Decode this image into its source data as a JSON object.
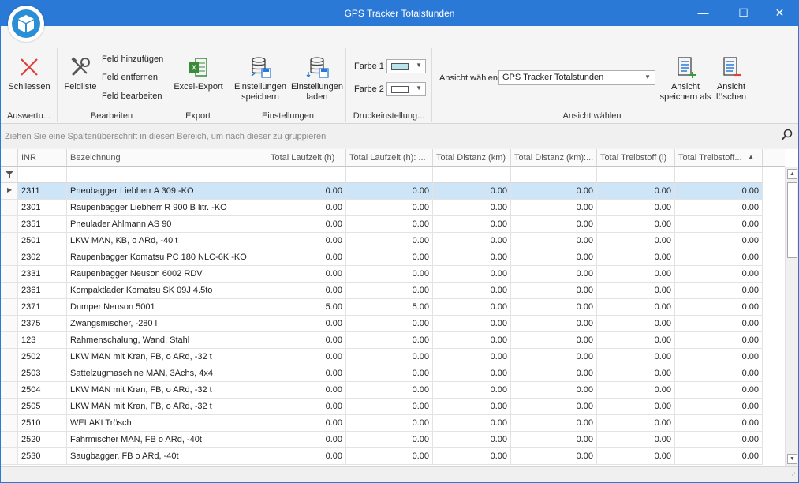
{
  "window": {
    "title": "GPS Tracker Totalstunden",
    "minimize_glyph": "—",
    "maximize_glyph": "☐",
    "close_glyph": "✕"
  },
  "ribbon": {
    "groups": {
      "auswertung": {
        "label": "Auswertu...",
        "close_label": "Schliessen",
        "close_icon": "red-x-icon"
      },
      "bearbeiten": {
        "label": "Bearbeiten",
        "fieldlist_label": "Feldliste",
        "add_field": "Feld hinzufügen",
        "remove_field": "Feld entfernen",
        "edit_field": "Feld bearbeiten"
      },
      "export": {
        "label": "Export",
        "excel_label": "Excel-Export"
      },
      "einstellungen": {
        "label": "Einstellungen",
        "save_line1": "Einstellungen",
        "save_line2": "speichern",
        "load_line1": "Einstellungen",
        "load_line2": "laden"
      },
      "druck": {
        "label": "Druckeinstellung...",
        "color1_label": "Farbe 1",
        "color1_value": "#b7e4ee",
        "color2_label": "Farbe 2",
        "color2_value": "#ffffff"
      },
      "ansicht": {
        "label": "Ansicht wählen",
        "select_label": "Ansicht wählen",
        "selected_view": "GPS Tracker Totalstunden",
        "save_as_line1": "Ansicht",
        "save_as_line2": "speichern als",
        "delete_line1": "Ansicht",
        "delete_line2": "löschen"
      }
    }
  },
  "groupbar": {
    "hint": "Ziehen Sie eine Spaltenüberschrift in diesen Bereich, um nach dieser zu gruppieren"
  },
  "grid": {
    "columns": [
      "INR",
      "Bezeichnung",
      "Total Laufzeit (h)",
      "Total Laufzeit (h): ...",
      "Total Distanz (km)",
      "Total Distanz (km):...",
      "Total Treibstoff (l)",
      "Total Treibstoff..."
    ],
    "sort_glyph": "▲",
    "rows": [
      {
        "inr": "2311",
        "bez": "Pneubagger Liebherr A 309 -KO",
        "lz": "0.00",
        "lz2": "0.00",
        "d": "0.00",
        "d2": "0.00",
        "t": "0.00",
        "t2": "0.00"
      },
      {
        "inr": "2301",
        "bez": "Raupenbagger Liebherr R 900 B litr. -KO",
        "lz": "0.00",
        "lz2": "0.00",
        "d": "0.00",
        "d2": "0.00",
        "t": "0.00",
        "t2": "0.00"
      },
      {
        "inr": "2351",
        "bez": "Pneulader Ahlmann AS 90",
        "lz": "0.00",
        "lz2": "0.00",
        "d": "0.00",
        "d2": "0.00",
        "t": "0.00",
        "t2": "0.00"
      },
      {
        "inr": "2501",
        "bez": "LKW MAN, KB, o ARd, -40 t",
        "lz": "0.00",
        "lz2": "0.00",
        "d": "0.00",
        "d2": "0.00",
        "t": "0.00",
        "t2": "0.00"
      },
      {
        "inr": "2302",
        "bez": "Raupenbagger Komatsu PC 180 NLC-6K -KO",
        "lz": "0.00",
        "lz2": "0.00",
        "d": "0.00",
        "d2": "0.00",
        "t": "0.00",
        "t2": "0.00"
      },
      {
        "inr": "2331",
        "bez": "Raupenbagger Neuson 6002 RDV",
        "lz": "0.00",
        "lz2": "0.00",
        "d": "0.00",
        "d2": "0.00",
        "t": "0.00",
        "t2": "0.00"
      },
      {
        "inr": "2361",
        "bez": "Kompaktlader Komatsu SK 09J 4.5to",
        "lz": "0.00",
        "lz2": "0.00",
        "d": "0.00",
        "d2": "0.00",
        "t": "0.00",
        "t2": "0.00"
      },
      {
        "inr": "2371",
        "bez": "Dumper Neuson 5001",
        "lz": "5.00",
        "lz2": "5.00",
        "d": "0.00",
        "d2": "0.00",
        "t": "0.00",
        "t2": "0.00"
      },
      {
        "inr": "2375",
        "bez": "Zwangsmischer, -280 l",
        "lz": "0.00",
        "lz2": "0.00",
        "d": "0.00",
        "d2": "0.00",
        "t": "0.00",
        "t2": "0.00"
      },
      {
        "inr": "123",
        "bez": "Rahmenschalung, Wand, Stahl",
        "lz": "0.00",
        "lz2": "0.00",
        "d": "0.00",
        "d2": "0.00",
        "t": "0.00",
        "t2": "0.00"
      },
      {
        "inr": "2502",
        "bez": "LKW MAN mit Kran, FB, o ARd, -32 t",
        "lz": "0.00",
        "lz2": "0.00",
        "d": "0.00",
        "d2": "0.00",
        "t": "0.00",
        "t2": "0.00"
      },
      {
        "inr": "2503",
        "bez": "Sattelzugmaschine MAN, 3Achs, 4x4",
        "lz": "0.00",
        "lz2": "0.00",
        "d": "0.00",
        "d2": "0.00",
        "t": "0.00",
        "t2": "0.00"
      },
      {
        "inr": "2504",
        "bez": "LKW MAN mit Kran, FB, o ARd, -32 t",
        "lz": "0.00",
        "lz2": "0.00",
        "d": "0.00",
        "d2": "0.00",
        "t": "0.00",
        "t2": "0.00"
      },
      {
        "inr": "2505",
        "bez": "LKW MAN mit Kran, FB, o ARd, -32 t",
        "lz": "0.00",
        "lz2": "0.00",
        "d": "0.00",
        "d2": "0.00",
        "t": "0.00",
        "t2": "0.00"
      },
      {
        "inr": "2510",
        "bez": "WELAKI Trösch",
        "lz": "0.00",
        "lz2": "0.00",
        "d": "0.00",
        "d2": "0.00",
        "t": "0.00",
        "t2": "0.00"
      },
      {
        "inr": "2520",
        "bez": "Fahrmischer MAN, FB o ARd, -40t",
        "lz": "0.00",
        "lz2": "0.00",
        "d": "0.00",
        "d2": "0.00",
        "t": "0.00",
        "t2": "0.00"
      },
      {
        "inr": "2530",
        "bez": "Saugbagger, FB o ARd, -40t",
        "lz": "0.00",
        "lz2": "0.00",
        "d": "0.00",
        "d2": "0.00",
        "t": "0.00",
        "t2": "0.00"
      }
    ],
    "selected_row": 0
  },
  "icons": {
    "app": "cube-icon",
    "search": "search-icon",
    "filter": "filter-icon"
  }
}
